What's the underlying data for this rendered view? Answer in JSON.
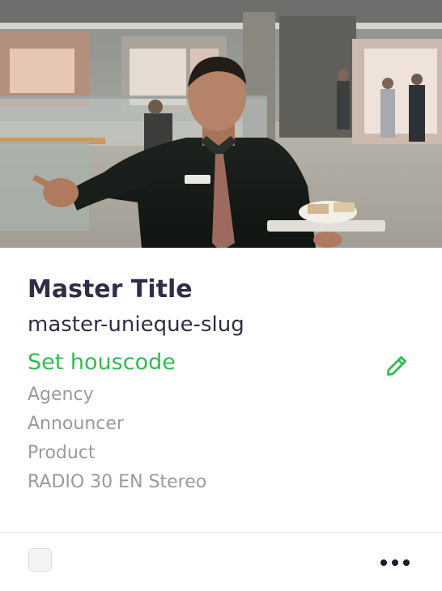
{
  "card": {
    "thumbnail": {
      "description_icon": "video-thumbnail"
    },
    "title": "Master Title",
    "slug": "master-unieque-slug",
    "housecode_action": "Set houscode",
    "edit_icon": "pencil-icon",
    "meta": {
      "agency": "Agency",
      "announcer": "Announcer",
      "product": "Product",
      "station": "RADIO 30 EN Stereo"
    },
    "footer": {
      "select_checkbox": "checkbox",
      "more_icon": "more-horizontal-icon"
    }
  },
  "colors": {
    "title": "#2e2e48",
    "accent_green": "#2fbd4d",
    "meta_gray": "#9a9a9a",
    "divider": "#e6e6e6"
  }
}
